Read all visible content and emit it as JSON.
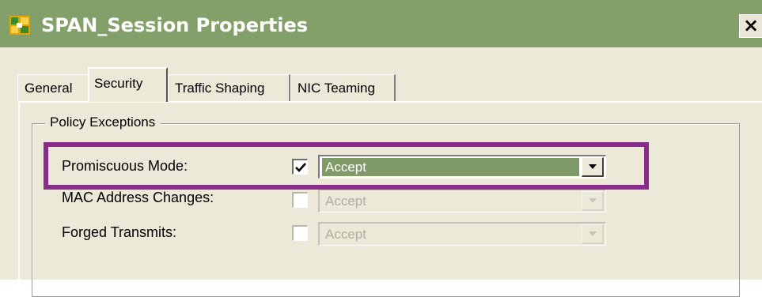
{
  "window": {
    "title": "SPAN_Session Properties",
    "close_label": "×",
    "title_color": "#84a06a"
  },
  "tabs": [
    {
      "label": "General",
      "active": false
    },
    {
      "label": "Security",
      "active": true
    },
    {
      "label": "Traffic Shaping",
      "active": false
    },
    {
      "label": "NIC Teaming",
      "active": false
    }
  ],
  "policy_exceptions": {
    "group_label": "Policy Exceptions",
    "rows": [
      {
        "label": "Promiscuous Mode:",
        "checked": true,
        "value": "Accept",
        "enabled": true
      },
      {
        "label": "MAC Address Changes:",
        "checked": false,
        "value": "Accept",
        "enabled": false
      },
      {
        "label": "Forged Transmits:",
        "checked": false,
        "value": "Accept",
        "enabled": false
      }
    ]
  },
  "annotation": {
    "highlight_color": "#8a2c8c"
  },
  "icons": {
    "app": "vsphere-portgroup-icon",
    "dropdown": "chevron-down-icon",
    "check": "checkmark-icon"
  }
}
